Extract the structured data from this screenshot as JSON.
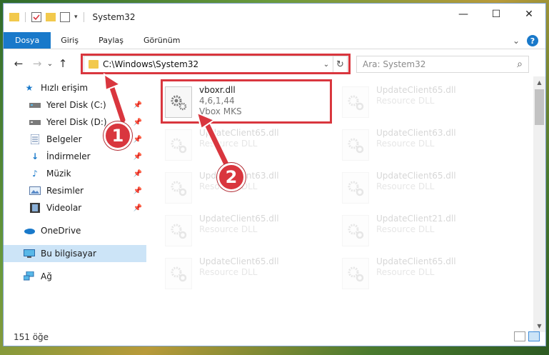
{
  "window": {
    "title": "System32",
    "controls": {
      "minimize": "—",
      "maximize": "☐",
      "close": "✕"
    }
  },
  "ribbon": {
    "tabs": [
      "Dosya",
      "Giriş",
      "Paylaş",
      "Görünüm"
    ],
    "expand_glyph": "⌄",
    "help_glyph": "?"
  },
  "address_bar": {
    "path": "C:\\Windows\\System32",
    "dropdown_glyph": "⌄",
    "refresh_glyph": "↻"
  },
  "search": {
    "placeholder": "Ara: System32",
    "search_glyph": "⌕"
  },
  "nav": {
    "back_glyph": "←",
    "forward_glyph": "→",
    "recent_glyph": "⌄",
    "up_glyph": "↑"
  },
  "nav_pane": {
    "quick_access_label": "Hızlı erişim",
    "quick_items": [
      {
        "label": "Yerel Disk (C:)",
        "icon": "drive-icon"
      },
      {
        "label": "Yerel Disk (D:)",
        "icon": "drive-icon"
      },
      {
        "label": "Belgeler",
        "icon": "documents-icon"
      },
      {
        "label": "İndirmeler",
        "icon": "downloads-icon"
      },
      {
        "label": "Müzik",
        "icon": "music-icon"
      },
      {
        "label": "Resimler",
        "icon": "pictures-icon"
      },
      {
        "label": "Videolar",
        "icon": "videos-icon"
      }
    ],
    "onedrive_label": "OneDrive",
    "this_pc_label": "Bu bilgisayar",
    "network_label": "Ağ"
  },
  "files": [
    {
      "name": "vboxr.dll",
      "line2": "4,6,1,44",
      "line3": "Vbox MKS",
      "highlighted": true
    },
    {
      "name": "UpdateClient65.dll",
      "line2": "Resource DLL"
    },
    {
      "name": "UpdateClient65.dll",
      "line2": "Resource DLL"
    },
    {
      "name": "UpdateClient63.dll",
      "line2": "Resource DLL"
    },
    {
      "name": "UpdateClient63.dll",
      "line2": "Resource DLL"
    },
    {
      "name": "UpdateClient65.dll",
      "line2": "Resource DLL"
    },
    {
      "name": "UpdateClient65.dll",
      "line2": "Resource DLL"
    },
    {
      "name": "UpdateClient21.dll",
      "line2": "Resource DLL"
    },
    {
      "name": "UpdateClient65.dll",
      "line2": "Resource DLL"
    },
    {
      "name": "UpdateClient65.dll",
      "line2": "Resource DLL"
    }
  ],
  "status": {
    "item_count": "151 öğe"
  },
  "callouts": [
    "1",
    "2"
  ],
  "colors": {
    "accent": "#1979ca",
    "highlight_red": "#d9363e",
    "selected_bg": "#cce4f7"
  }
}
